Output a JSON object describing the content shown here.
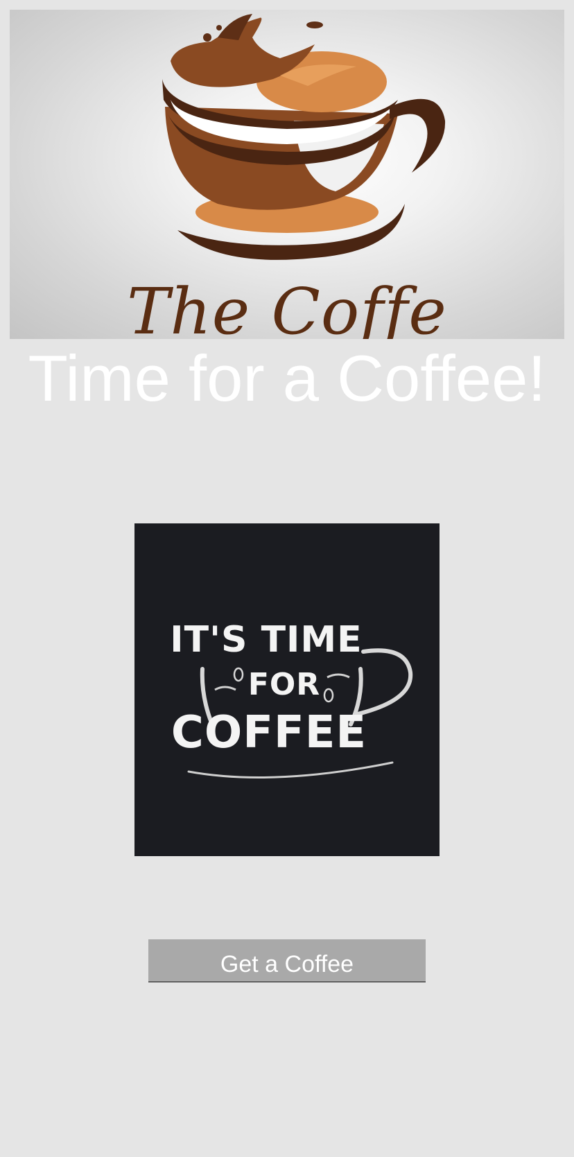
{
  "banner": {
    "logo_text": "The Coffe",
    "icon": "coffee-cup-splash-logo"
  },
  "headline": "Time for a Coffee!",
  "poster": {
    "icon": "chalk-coffee-cup-illustration",
    "line1": "IT'S TIME",
    "line2": "FOR",
    "line3": "COFFEE"
  },
  "button": {
    "label": "Get a Coffee"
  },
  "colors": {
    "background": "#e5e5e5",
    "button": "#a9a9a9",
    "poster_bg": "#1b1c21",
    "coffee_dark": "#4a2512",
    "coffee_mid": "#8a4a22",
    "coffee_light": "#d88a48"
  }
}
